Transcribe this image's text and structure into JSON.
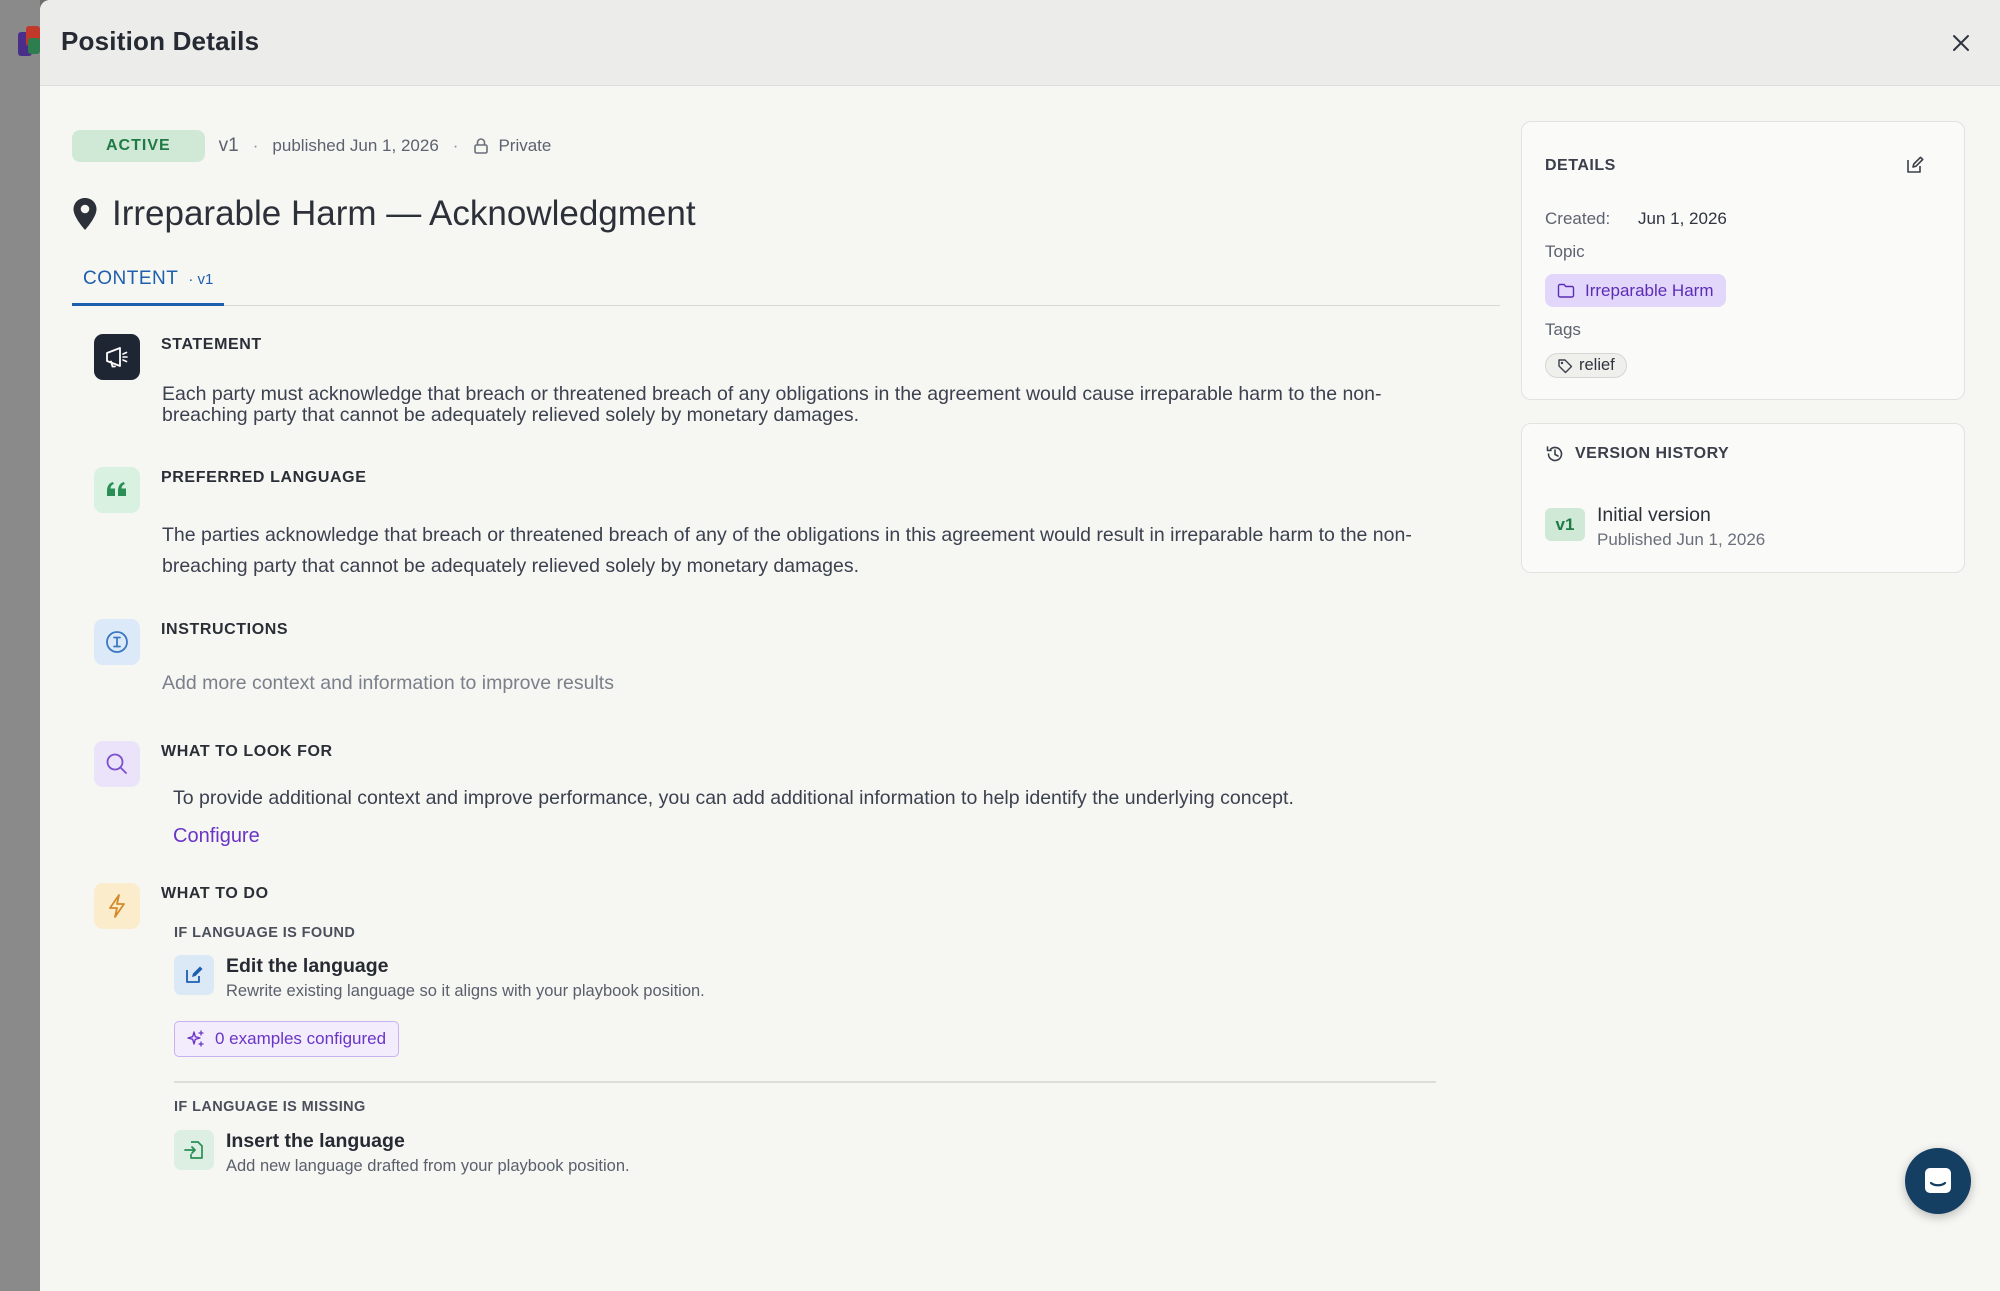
{
  "modal": {
    "title": "Position Details"
  },
  "meta": {
    "status": "ACTIVE",
    "version": "v1",
    "published": "published Jun 1, 2026",
    "visibility": "Private",
    "separator": "·"
  },
  "position": {
    "title": "Irreparable Harm — Acknowledgment"
  },
  "tabs": [
    {
      "label": "CONTENT",
      "version": "· v1"
    }
  ],
  "sections": {
    "statement": {
      "title": "STATEMENT",
      "body": "Each party must acknowledge that breach or threatened breach of any obligations in the agreement would cause irreparable harm to the non-breaching party that cannot be adequately relieved solely by monetary damages."
    },
    "preferred_language": {
      "title": "PREFERRED LANGUAGE",
      "body": "The parties acknowledge that breach or threatened breach of any of the obligations in this agreement would result in irreparable harm to the non-breaching party that cannot be adequately relieved solely by monetary damages."
    },
    "instructions": {
      "title": "INSTRUCTIONS",
      "placeholder": "Add more context and information to improve results"
    },
    "what_to_look_for": {
      "title": "WHAT TO LOOK FOR",
      "body": "To provide additional context and improve performance, you can add additional information to help identify the underlying concept.",
      "link": "Configure"
    },
    "what_to_do": {
      "title": "WHAT TO DO",
      "found_label": "IF LANGUAGE IS FOUND",
      "edit_title": "Edit the language",
      "edit_desc": "Rewrite existing language so it aligns with your playbook position.",
      "examples": "0 examples configured",
      "missing_label": "IF LANGUAGE IS MISSING",
      "insert_title": "Insert the language",
      "insert_desc": "Add new language drafted from your playbook position."
    }
  },
  "details": {
    "heading": "DETAILS",
    "created_label": "Created:",
    "created_value": "Jun 1, 2026",
    "topic_label": "Topic",
    "topic_value": "Irreparable Harm",
    "tags_label": "Tags",
    "tags": [
      "relief"
    ]
  },
  "version_history": {
    "heading": "VERSION HISTORY",
    "items": [
      {
        "badge": "v1",
        "title": "Initial version",
        "subtitle": "Published Jun 1, 2026"
      }
    ]
  },
  "colors": {
    "accent_blue": "#1d5fae",
    "accent_purple": "#6a35c7",
    "active_green": "#1f7a45",
    "chat_navy": "#153e63"
  }
}
